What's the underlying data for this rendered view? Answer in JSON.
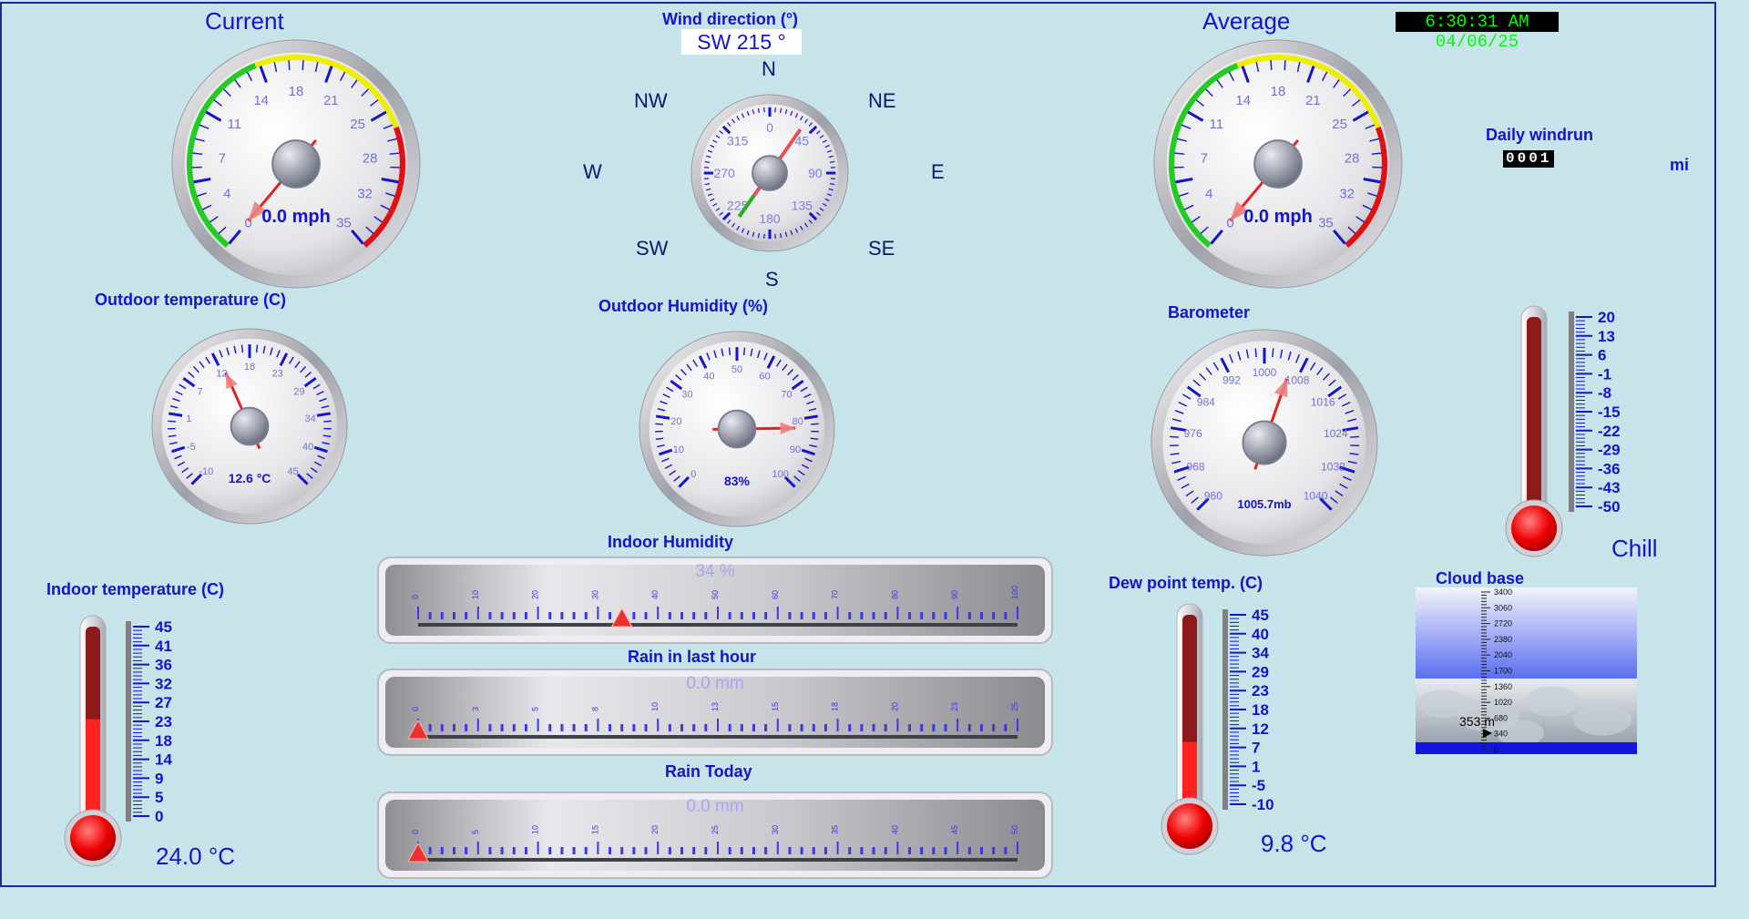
{
  "clock": "6:30:31 AM 04/06/25",
  "current_wind": {
    "title": "Current",
    "ticks": [
      "0",
      "4",
      "7",
      "11",
      "14",
      "18",
      "21",
      "25",
      "28",
      "32",
      "35"
    ],
    "value": 0.0,
    "needle_value": 0,
    "readout": "0.0 mph"
  },
  "average_wind": {
    "title": "Average",
    "ticks": [
      "0",
      "4",
      "7",
      "11",
      "14",
      "18",
      "21",
      "25",
      "28",
      "32",
      "35"
    ],
    "value": 0.0,
    "needle_value": 0,
    "readout": "0.0 mph"
  },
  "wind_direction": {
    "title": "Wind direction (°)",
    "readout": "SW  215 °",
    "bearing_deg": 215,
    "compass": {
      "n": "N",
      "ne": "NE",
      "e": "E",
      "se": "SE",
      "s": "S",
      "sw": "SW",
      "w": "W",
      "nw": "NW"
    },
    "ticks": [
      "0",
      "45",
      "90",
      "135",
      "180",
      "225",
      "270",
      "315"
    ]
  },
  "outdoor_temperature": {
    "title": "Outdoor temperature (C)",
    "ticks": [
      "-10",
      "-5",
      "1",
      "7",
      "12",
      "18",
      "23",
      "29",
      "34",
      "40",
      "45"
    ],
    "value": 12.6,
    "readout": "12.6 °C"
  },
  "outdoor_humidity": {
    "title": "Outdoor Humidity (%)",
    "ticks": [
      "0",
      "10",
      "20",
      "30",
      "40",
      "50",
      "60",
      "70",
      "80",
      "90",
      "100"
    ],
    "value": 83,
    "readout": "83%"
  },
  "barometer": {
    "title": "Barometer",
    "ticks": [
      "960",
      "968",
      "976",
      "984",
      "992",
      "1000",
      "1008",
      "1016",
      "1024",
      "1032",
      "1040"
    ],
    "value": 1005.7,
    "readout": "1005.7mb"
  },
  "daily_windrun": {
    "title": "Daily windrun",
    "digits": "0001",
    "unit": "mi"
  },
  "wind_chill": {
    "label": "Chill",
    "ticks": [
      "20",
      "13",
      "6",
      "-1",
      "-8",
      "-15",
      "-22",
      "-29",
      "-36",
      "-43",
      "-50"
    ],
    "level_fraction": 0.0
  },
  "indoor_temperature": {
    "title": "Indoor temperature (C)",
    "ticks": [
      "45",
      "41",
      "36",
      "32",
      "27",
      "23",
      "18",
      "14",
      "9",
      "5",
      "0"
    ],
    "value": 24.0,
    "readout": "24.0 °C"
  },
  "dew_point": {
    "title": "Dew point temp. (C)",
    "ticks": [
      "45",
      "40",
      "34",
      "29",
      "23",
      "18",
      "12",
      "7",
      "1",
      "-5",
      "-10"
    ],
    "value": 9.8,
    "readout": "9.8 °C"
  },
  "indoor_humidity": {
    "title": "Indoor Humidity",
    "readout": "34 %",
    "value": 34,
    "ticks": [
      "0",
      "10",
      "20",
      "30",
      "40",
      "50",
      "60",
      "70",
      "80",
      "90",
      "100"
    ]
  },
  "rain_last_hour": {
    "title": "Rain in last hour",
    "readout": "0.0 mm",
    "value": 0.0,
    "ticks": [
      "0",
      "3",
      "5",
      "8",
      "10",
      "13",
      "15",
      "18",
      "20",
      "23",
      "25"
    ]
  },
  "rain_today": {
    "title": "Rain Today",
    "readout": "0.0 mm",
    "value": 0.0,
    "ticks": [
      "0",
      "5",
      "10",
      "15",
      "20",
      "25",
      "30",
      "35",
      "40",
      "45",
      "50"
    ]
  },
  "cloud_base": {
    "title": "Cloud base",
    "ticks": [
      "3400",
      "3060",
      "2720",
      "2380",
      "2040",
      "1700",
      "1360",
      "1020",
      "680",
      "340",
      "0"
    ],
    "value": 353,
    "readout": "353 m"
  },
  "colors": {
    "text": "#1414c8",
    "background": "#c6e4ea",
    "needle": "#e82020",
    "tick": "#1414c8",
    "scale_green": "#22cc22",
    "scale_yellow": "#eeee00",
    "scale_red": "#dd1111",
    "clock_fg": "#00ff00",
    "clock_bg": "#000000"
  }
}
